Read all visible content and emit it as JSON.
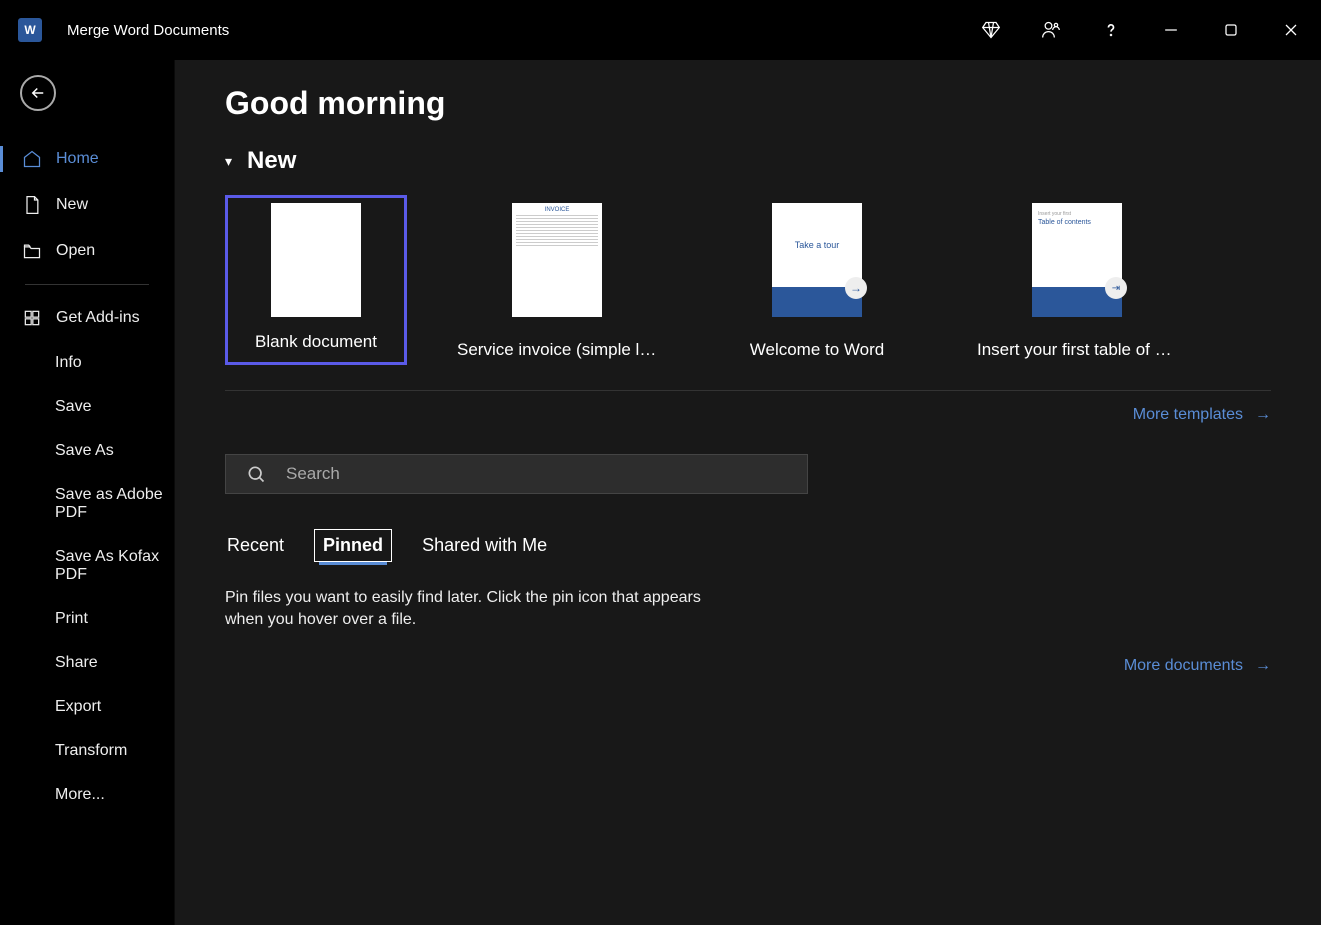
{
  "titlebar": {
    "doc_title": "Merge Word Documents"
  },
  "sidebar": {
    "items": [
      {
        "label": "Home",
        "icon": "home",
        "active": true
      },
      {
        "label": "New",
        "icon": "file"
      },
      {
        "label": "Open",
        "icon": "folder"
      }
    ],
    "addins": {
      "label": "Get Add-ins",
      "icon": "grid"
    },
    "sub_items": [
      "Info",
      "Save",
      "Save As",
      "Save as Adobe PDF",
      "Save As Kofax PDF",
      "Print",
      "Share",
      "Export",
      "Transform",
      "More..."
    ]
  },
  "content": {
    "greeting": "Good morning",
    "new_section": "New",
    "templates": [
      {
        "label": "Blank document"
      },
      {
        "label": "Service invoice (simple line…"
      },
      {
        "label": "Welcome to Word"
      },
      {
        "label": "Insert your first table of con…"
      }
    ],
    "more_templates": "More templates",
    "search_placeholder": "Search",
    "tabs": [
      "Recent",
      "Pinned",
      "Shared with Me"
    ],
    "active_tab": "Pinned",
    "pinned_text": "Pin files you want to easily find later. Click the pin icon that appears when you hover over a file.",
    "more_documents": "More documents",
    "welcome_thumb_text": "Take a tour",
    "toc_thumb_small": "Insert your first",
    "toc_thumb_big": "Table of contents",
    "invoice_hdr": "INVOICE"
  }
}
